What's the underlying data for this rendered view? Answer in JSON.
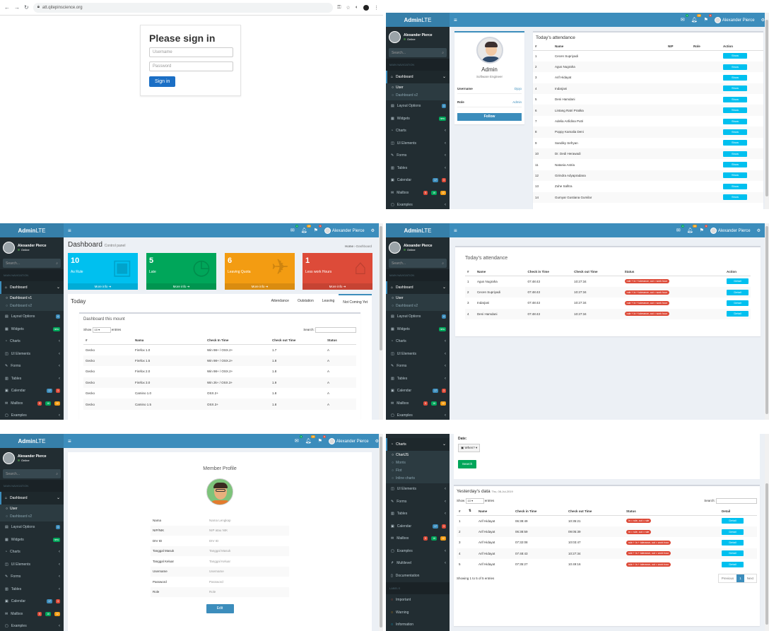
{
  "brand": {
    "logo_bold": "Admin",
    "logo_light": "LTE"
  },
  "user": {
    "name": "Alexander Pierce",
    "status": "Online"
  },
  "colors": {
    "header": "#3c8dbc",
    "sidebar": "#222d32",
    "info": "#00c0ef",
    "danger": "#dd4b39",
    "primary_btn": "#1b6fc5"
  },
  "p1": {
    "url": "att.qitepinscience.org",
    "title": "Please sign in",
    "username_ph": "Username",
    "password_ph": "Password",
    "signin": "Sign in"
  },
  "sidebar_search": "Search...",
  "nav_header": "MAIN NAVIGATION",
  "labels_header": "LABELS",
  "nav": {
    "dashboard": "Dashboard",
    "user": "User",
    "dashboard_v1": "Dashboard v1",
    "dashboard_v2": "Dashboard v2",
    "layout": "Layout Options",
    "widgets": "Widgets",
    "charts": "Charts",
    "ui": "UI Elements",
    "forms": "Forms",
    "tables": "Tables",
    "calendar": "Calendar",
    "mailbox": "Mailbox",
    "examples": "Examples",
    "multilevel": "Multilevel",
    "documentation": "Documentation",
    "chartjs": "ChartJS",
    "morris": "Morris",
    "flot": "Flot",
    "inline": "Inline charts",
    "important": "Important",
    "warning": "Warning",
    "information": "Information"
  },
  "badges": {
    "layout": "4",
    "widgets": "new",
    "cal1": "17",
    "cal2": "3",
    "mail1": "5",
    "mail2": "16",
    "mail3": "12",
    "notif": "10",
    "msg": "4",
    "flag": "9"
  },
  "p2": {
    "profile_name": "Admin",
    "profile_role": "Software Engineer",
    "username_label": "Username",
    "username_val": "Djojo",
    "role_label": "Role",
    "role_val": "Admin",
    "follow": "Follow",
    "att_title": "Today's attendance",
    "cols": [
      "#",
      "Name",
      "NIP",
      "Role",
      "Action"
    ],
    "show": "Show",
    "rows": [
      [
        "1",
        "Cecen Supriyadi"
      ],
      [
        "2",
        "Agus Nugraha"
      ],
      [
        "3",
        "Arif Hidayat"
      ],
      [
        "4",
        "Indarjani"
      ],
      [
        "5",
        "Deni Hamdani"
      ],
      [
        "6",
        "Lintang Ratri Pratika"
      ],
      [
        "7",
        "Adelia Anfidina Putri"
      ],
      [
        "8",
        "Poppy Kamalia Deni"
      ],
      [
        "9",
        "Sandiky Sefryan"
      ],
      [
        "10",
        "Dr. Dedi Herawadi"
      ],
      [
        "11",
        "Natania Astria"
      ],
      [
        "12",
        "Girindra Adyapradana"
      ],
      [
        "13",
        "Zuhe Safitra"
      ],
      [
        "14",
        "Gumyar Gustiana Gumilar"
      ]
    ]
  },
  "p3": {
    "title": "Dashboard",
    "subtitle": "Control panel",
    "bc_home": "Home",
    "bc_cur": "Dashboard",
    "boxes": [
      {
        "num": "10",
        "text": "As Rule",
        "more": "More info"
      },
      {
        "num": "5",
        "text": "Late",
        "more": "More info"
      },
      {
        "num": "6",
        "text": "Leaving Quota",
        "more": "More info"
      },
      {
        "num": "1",
        "text": "Less work Hours",
        "more": "More info"
      }
    ],
    "tab_title": "Today",
    "tabs": [
      "Attendance",
      "Outstation",
      "Leaving",
      "Not Coming Yet"
    ],
    "box_title": "Dashboard this mount",
    "show": "Show",
    "entries_val": "10",
    "entries": "entries",
    "search": "Search:",
    "cols": [
      "#",
      "Nama",
      "Check In Time",
      "Check out Time",
      "Status"
    ],
    "rows": [
      [
        "Gecko",
        "Firefox 1.0",
        "Win 98+ / OSX.2+",
        "1.7",
        "A"
      ],
      [
        "Gecko",
        "Firefox 1.5",
        "Win 98+ / OSX.2+",
        "1.8",
        "A"
      ],
      [
        "Gecko",
        "Firefox 2.0",
        "Win 98+ / OSX.2+",
        "1.8",
        "A"
      ],
      [
        "Gecko",
        "Firefox 3.0",
        "Win 2k+ / OSX.3+",
        "1.9",
        "A"
      ],
      [
        "Gecko",
        "Camino 1.0",
        "OSX.2+",
        "1.8",
        "A"
      ],
      [
        "Gecko",
        "Camino 1.5",
        "OSX.3+",
        "1.8",
        "A"
      ]
    ]
  },
  "p4": {
    "title": "Today's attendance",
    "cols": [
      "#",
      "Name",
      "Check in Time",
      "Check out Time",
      "Status",
      "Action"
    ],
    "detail": "Detail",
    "rows": [
      [
        "1",
        "Agus Nugraha",
        "07:48:43",
        "10:27:34",
        "rule + In + tolerance, out = work hour"
      ],
      [
        "2",
        "Cecen Supriyadi",
        "07:48:43",
        "10:27:34",
        "rule + In + tolerance, out = work hour"
      ],
      [
        "3",
        "Indarjani",
        "07:48:43",
        "10:27:34",
        "rule + In + tolerance, out = work hour"
      ],
      [
        "4",
        "Deni Hamdani",
        "07:48:43",
        "10:27:34",
        "rule + In + tolerance, out = work hour"
      ]
    ]
  },
  "p5": {
    "title": "Member Profile",
    "edit": "Edit",
    "fields": [
      [
        "Nama",
        "Nama Lengkap"
      ],
      [
        "NIP/NIK",
        "NIP atau NIK"
      ],
      [
        "DIV ID",
        "DIV ID"
      ],
      [
        "Tanggal Masuk",
        "Tanggal Masuk"
      ],
      [
        "Tanggal Keluar",
        "Tanggal Keluar"
      ],
      [
        "Username",
        "Username"
      ],
      [
        "Password",
        "Password"
      ],
      [
        "Role",
        "Role"
      ]
    ]
  },
  "p6": {
    "date_label": "Date:",
    "when": "When?",
    "search_btn": "Search",
    "title": "Yesterday's data",
    "date": "Thu, 08-Jul-2019",
    "show": "Show",
    "entries_val": "10",
    "entries": "entries",
    "search": "Search:",
    "cols": [
      "#",
      "Name",
      "Check in Time",
      "Check out Time",
      "Status",
      "Detail"
    ],
    "detail": "Detail",
    "rows": [
      [
        "1",
        "Arif Hidayat",
        "06:38:49",
        "10:35:21",
        "In = rule, out = rule"
      ],
      [
        "2",
        "Arif Hidayat",
        "06:38:59",
        "09:05:39",
        "In = rule, out = rule"
      ],
      [
        "3",
        "Arif Hidayat",
        "07:32:08",
        "10:03:47",
        "rule + In + tolerance, out = work hour"
      ],
      [
        "4",
        "Arif Hidayat",
        "07:48:43",
        "10:27:34",
        "rule + In + tolerance, out = work hour"
      ],
      [
        "5",
        "Arif Hidayat",
        "07:35:27",
        "10:49:16",
        "rule + In + tolerance, out = work hour"
      ]
    ],
    "info": "Showing 1 to 5 of 5 entries",
    "prev": "Previous",
    "page": "1",
    "next": "Next"
  }
}
